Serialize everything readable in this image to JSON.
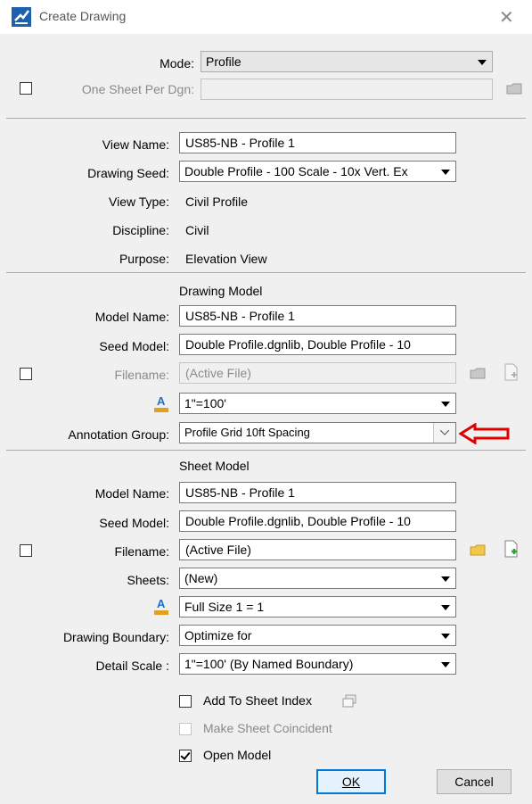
{
  "window": {
    "title": "Create Drawing",
    "close_glyph": "✕"
  },
  "top": {
    "mode_label": "Mode:",
    "mode_value": "Profile",
    "one_sheet_label": "One Sheet Per Dgn:",
    "one_sheet_value": ""
  },
  "view": {
    "view_name_label": "View Name:",
    "view_name_value": "US85-NB - Profile 1",
    "drawing_seed_label": "Drawing Seed:",
    "drawing_seed_value": "Double Profile - 100 Scale - 10x Vert. Ex",
    "view_type_label": "View Type:",
    "view_type_value": "Civil Profile",
    "discipline_label": "Discipline:",
    "discipline_value": "Civil",
    "purpose_label": "Purpose:",
    "purpose_value": "Elevation View"
  },
  "drawing_model": {
    "heading": "Drawing Model",
    "model_name_label": "Model Name:",
    "model_name_value": "US85-NB - Profile 1",
    "seed_model_label": "Seed Model:",
    "seed_model_value": "Double Profile.dgnlib, Double Profile - 10",
    "filename_label": "Filename:",
    "filename_value": "(Active File)",
    "annotation_scale_value": "1\"=100'",
    "annotation_group_label": "Annotation Group:",
    "annotation_group_value": "Profile Grid 10ft Spacing"
  },
  "sheet_model": {
    "heading": "Sheet Model",
    "model_name_label": "Model Name:",
    "model_name_value": "US85-NB - Profile 1",
    "seed_model_label": "Seed Model:",
    "seed_model_value": "Double Profile.dgnlib, Double Profile - 10",
    "filename_label": "Filename:",
    "filename_value": "(Active File)",
    "sheets_label": "Sheets:",
    "sheets_value": "(New)",
    "annotation_scale_value": "Full Size 1 = 1",
    "drawing_boundary_label": "Drawing Boundary:",
    "drawing_boundary_value": "Optimize for",
    "detail_scale_label": "Detail Scale :",
    "detail_scale_value": "1\"=100' (By Named Boundary)"
  },
  "options": {
    "add_to_sheet_index": "Add To Sheet Index",
    "make_sheet_coincident": "Make Sheet Coincident",
    "open_model": "Open Model",
    "open_model_checked": true
  },
  "buttons": {
    "ok": "OK",
    "cancel": "Cancel"
  },
  "colors": {
    "arrow_red": "#e00000",
    "folder_yellow": "#f2c84b",
    "default_button_border": "#0078d7"
  }
}
